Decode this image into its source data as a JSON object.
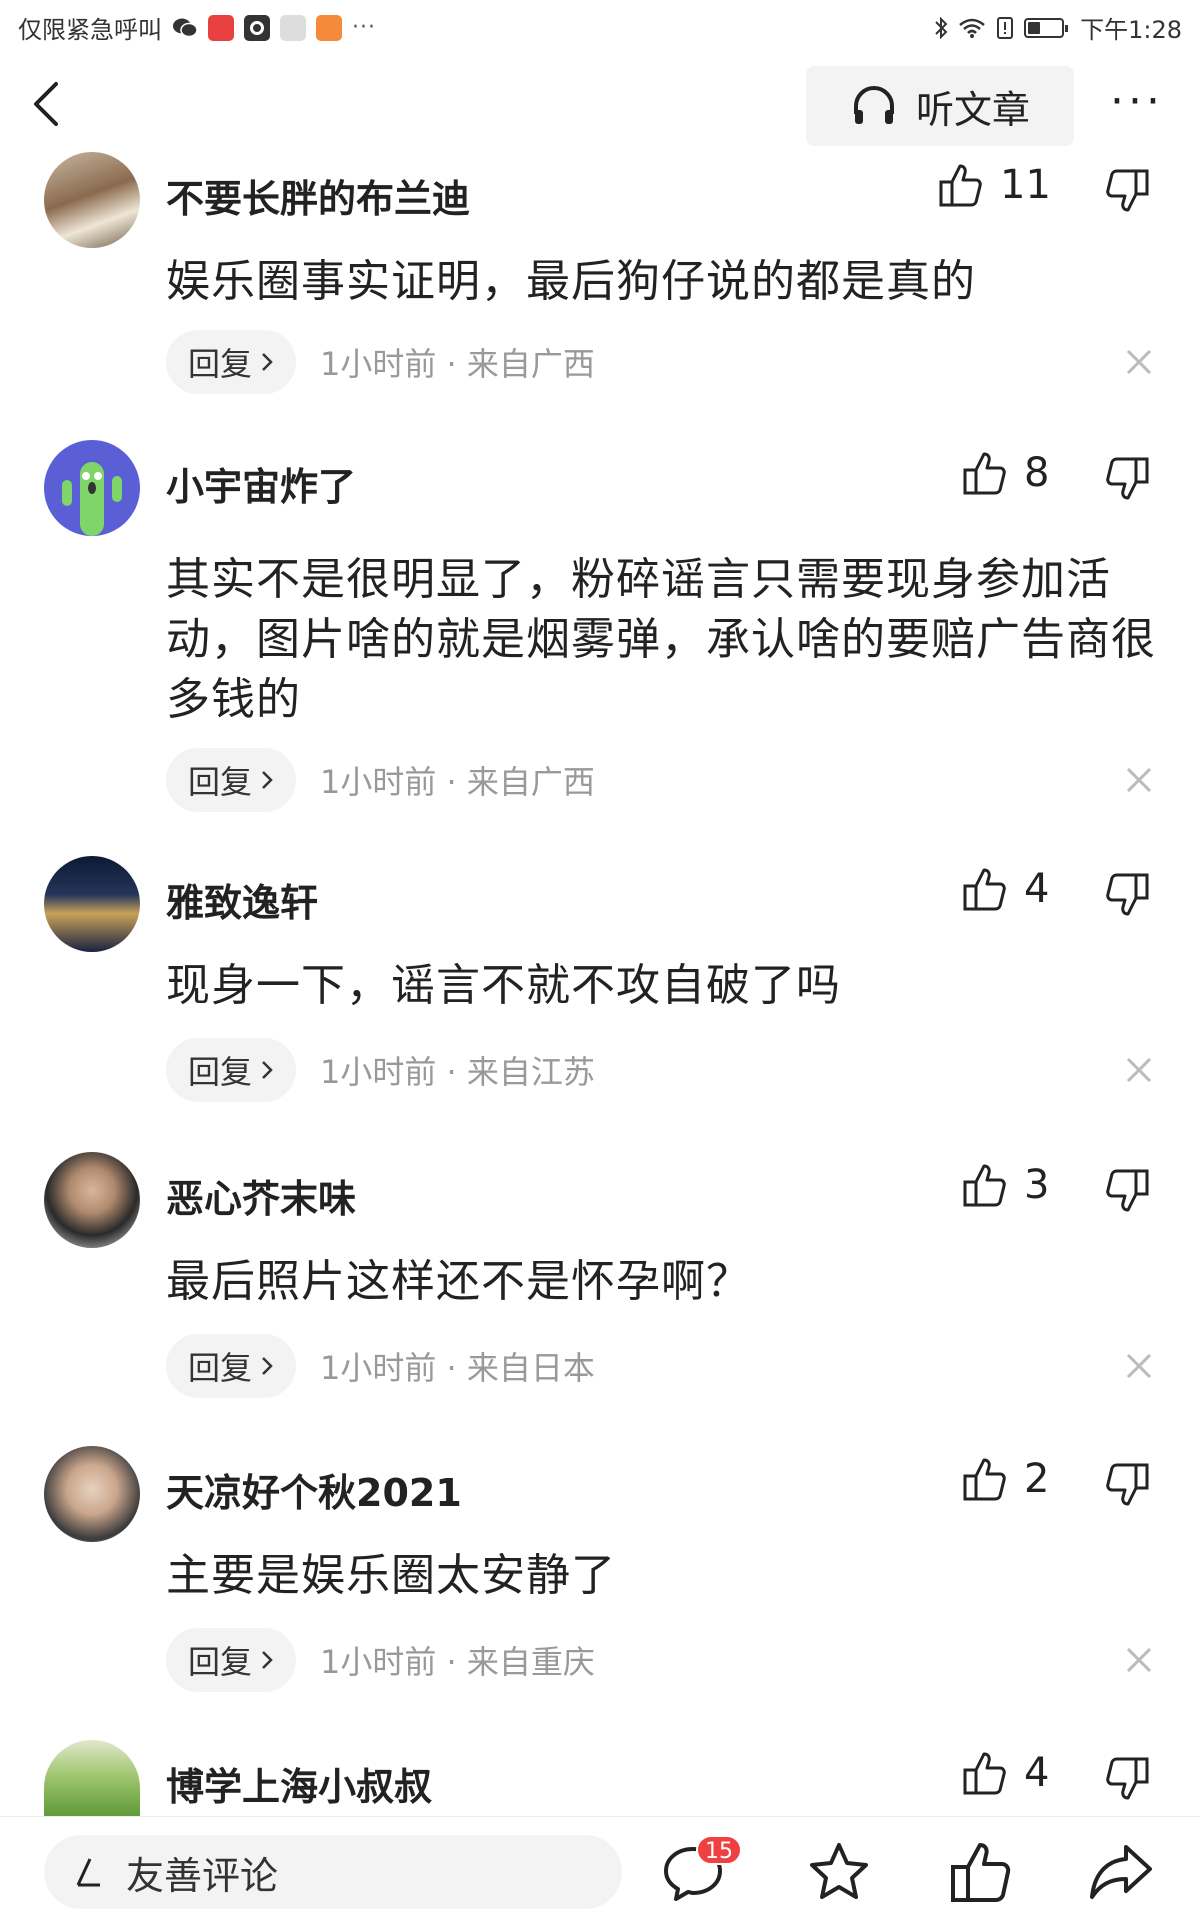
{
  "status_bar": {
    "carrier": "仅限紧急呼叫",
    "time": "下午1:28",
    "icons": [
      "wechat-icon",
      "toutiao-icon",
      "camera-app-icon",
      "font-app-icon",
      "orange-app-icon",
      "bluetooth-icon",
      "wifi-icon",
      "alert-icon",
      "battery-icon"
    ],
    "overflow": "···"
  },
  "nav": {
    "back_icon": "chevron-left-icon",
    "listen_label": "听文章",
    "listen_icon": "headphones-icon",
    "more_label": "···"
  },
  "comments": [
    {
      "user": "不要长胖的布兰迪",
      "likes": "11",
      "text": "娱乐圈事实证明，最后狗仔说的都是真的",
      "reply_label": "回复",
      "meta": "1小时前 · 来自广西"
    },
    {
      "user": "小宇宙炸了",
      "likes": "8",
      "text": "其实不是很明显了，粉碎谣言只需要现身参加活动，图片啥的就是烟雾弹，承认啥的要赔广告商很多钱的",
      "reply_label": "回复",
      "meta": "1小时前 · 来自广西"
    },
    {
      "user": "雅致逸轩",
      "likes": "4",
      "text": "现身一下，谣言不就不攻自破了吗",
      "reply_label": "回复",
      "meta": "1小时前 · 来自江苏"
    },
    {
      "user": "恶心芥末味",
      "likes": "3",
      "text": "最后照片这样还不是怀孕啊？",
      "reply_label": "回复",
      "meta": "1小时前 · 来自日本"
    },
    {
      "user": "天凉好个秋2021",
      "likes": "2",
      "text": "主要是娱乐圈太安静了",
      "reply_label": "回复",
      "meta": "1小时前 · 来自重庆"
    },
    {
      "user": "博学上海小叔叔",
      "likes": "4"
    }
  ],
  "bottom_bar": {
    "input_placeholder": "友善评论",
    "comment_count": "15",
    "icons": [
      "pen-icon",
      "comment-icon",
      "star-icon",
      "thumbs-up-icon",
      "share-icon"
    ]
  },
  "colors": {
    "badge": "#f04142",
    "pill_bg": "#f3f3f3",
    "meta_text": "#999999"
  }
}
